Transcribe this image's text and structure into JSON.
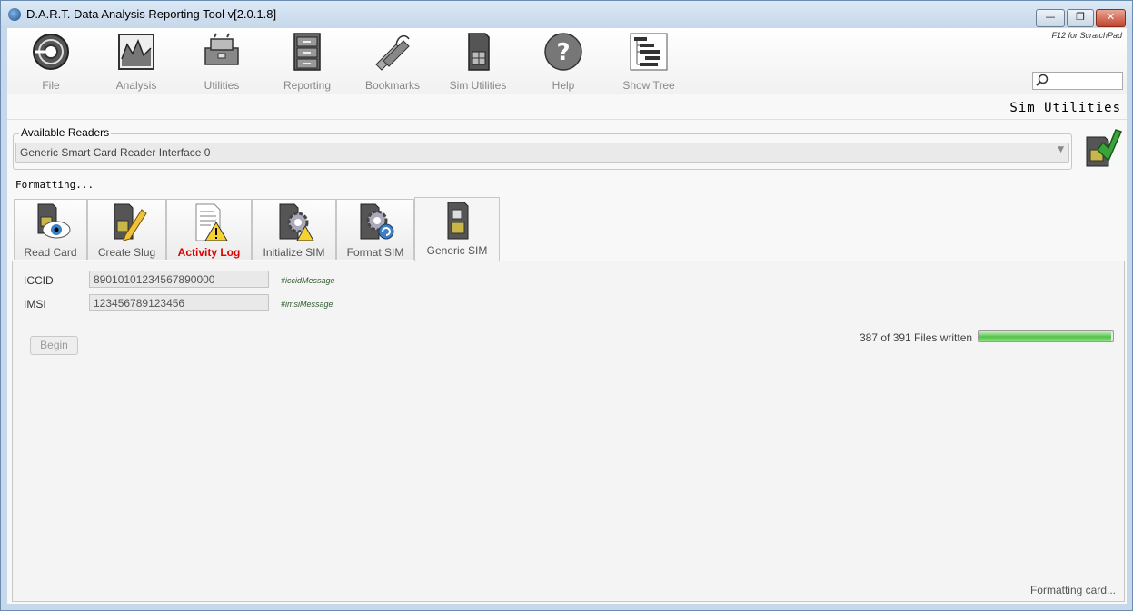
{
  "window": {
    "title": "D.A.R.T. Data Analysis Reporting Tool v[2.0.1.8]",
    "controls": {
      "minimize": "—",
      "maximize": "❐",
      "close": "✕"
    }
  },
  "toolbar": {
    "items": [
      {
        "label": "File",
        "icon": "file-disc-icon"
      },
      {
        "label": "Analysis",
        "icon": "analysis-chart-icon"
      },
      {
        "label": "Utilities",
        "icon": "toolbox-icon"
      },
      {
        "label": "Reporting",
        "icon": "filing-cabinet-icon"
      },
      {
        "label": "Bookmarks",
        "icon": "bookmarks-icon"
      },
      {
        "label": "Sim Utilities",
        "icon": "sim-card-icon"
      },
      {
        "label": "Help",
        "icon": "help-icon"
      },
      {
        "label": "Show Tree",
        "icon": "tree-icon"
      }
    ],
    "scratchpad_hint": "F12 for ScratchPad",
    "search": {
      "value": "",
      "placeholder": ""
    }
  },
  "section_title": "Sim Utilities",
  "readers": {
    "legend": "Available Readers",
    "selected": "Generic Smart Card Reader Interface 0"
  },
  "status": "Formatting...",
  "tabs": [
    {
      "label": "Read Card",
      "icon": "sim-eye-icon",
      "alert": false
    },
    {
      "label": "Create Slug",
      "icon": "sim-pencil-icon",
      "alert": false
    },
    {
      "label": "Activity Log",
      "icon": "log-warning-icon",
      "alert": true
    },
    {
      "label": "Initialize SIM",
      "icon": "sim-gear-warning-icon",
      "alert": false
    },
    {
      "label": "Format SIM",
      "icon": "sim-gear-refresh-icon",
      "alert": false
    },
    {
      "label": "Generic SIM",
      "icon": "sim-card-icon",
      "alert": false,
      "active": true
    }
  ],
  "form": {
    "iccid": {
      "label": "ICCID",
      "value": "89010101234567890000",
      "message": "#iccidMessage"
    },
    "imsi": {
      "label": "IMSI",
      "value": "123456789123456",
      "message": "#imsiMessage"
    },
    "begin_label": "Begin"
  },
  "progress": {
    "text": "387 of 391 Files written",
    "written": 387,
    "total": 391
  },
  "footer_status": "Formatting card...",
  "colors": {
    "alert_tab": "#dd0000",
    "progress_green": "#54c24a"
  }
}
